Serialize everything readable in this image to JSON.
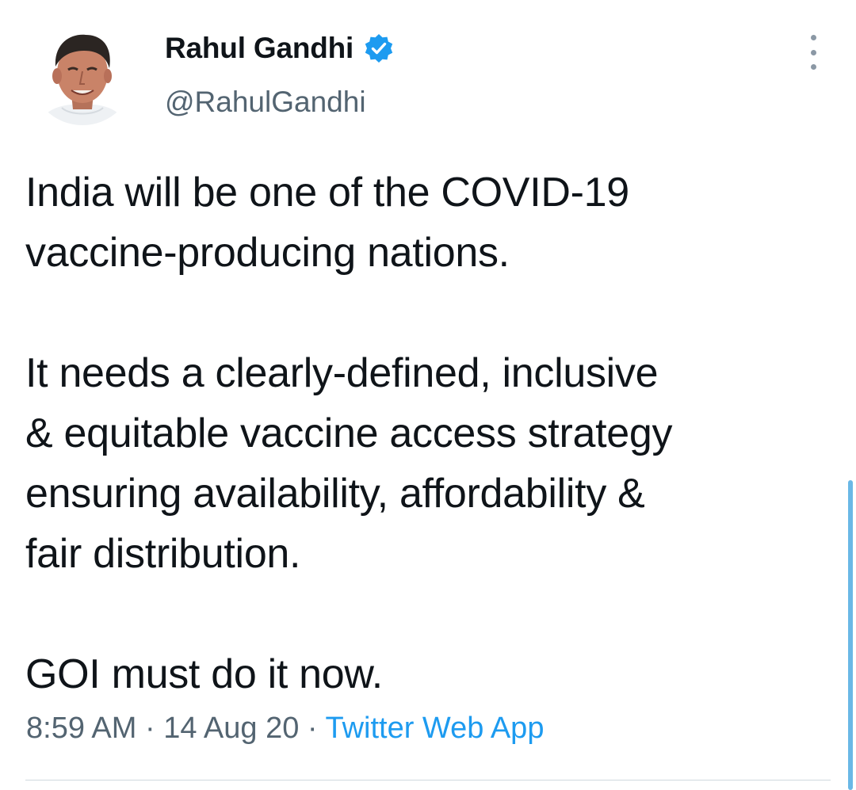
{
  "author": {
    "display_name": "Rahul Gandhi",
    "handle": "@RahulGandhi",
    "verified": true
  },
  "tweet": {
    "text": "India will be one of the COVID-19\nvaccine-producing nations.\n\nIt needs a clearly-defined, inclusive\n& equitable vaccine access strategy\nensuring availability, affordability &\nfair distribution.\n\nGOI must do it now.",
    "time": "8:59 AM",
    "date": "14 Aug 20",
    "separator": " · ",
    "source": "Twitter Web App"
  },
  "icons": {
    "verified": "verified-badge-icon",
    "more": "more-options-icon"
  },
  "colors": {
    "verified_badge": "#1d9bf0",
    "link": "#1d9bf0",
    "secondary_text": "#536471",
    "scrollbar": "#6ab8e6"
  }
}
